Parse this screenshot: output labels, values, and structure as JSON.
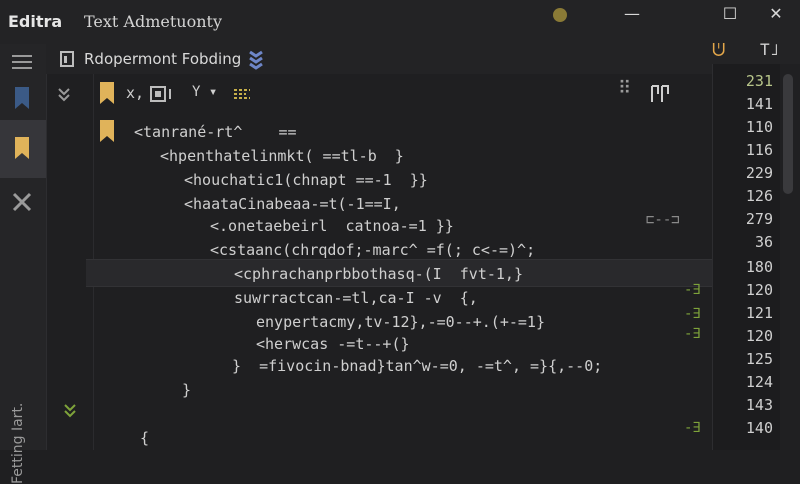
{
  "window": {
    "app_name": "Editra",
    "subtitle": "Text Admetuonty",
    "minimize": "—",
    "maximize": "☐",
    "close": "✕"
  },
  "tab": {
    "title": "Rdopermont Fobding",
    "actions": [
      "ᕫ",
      "T˩"
    ]
  },
  "toolbar": {
    "x_label": "x,",
    "filter_label": "Y ▾",
    "dots": "⠿"
  },
  "sidebar": {
    "vertical_label": "Fetting Iart."
  },
  "code_lines": [
    {
      "indent": 0,
      "text": "<tanrané-rt^    ==",
      "color": "#d6d6d6"
    },
    {
      "indent": 1,
      "text": "<hpenthatelinmkt( ==tl-b  }",
      "color": "#d9d9d9"
    },
    {
      "indent": 2,
      "text": "<houchatic1(chnapt ==-1  }}",
      "color": "#d9d9d9"
    },
    {
      "indent": 2,
      "text": "<haataCinabeaa-=t(-1==I,",
      "color": "#d9d9d9"
    },
    {
      "indent": 3,
      "text": "<.onetaebeirl  catnoa-=1 }}",
      "color": "#d9d9d9"
    },
    {
      "indent": 3,
      "text": "<cstaanc(chrqdof;-marc^ =f(; c<-=)^;",
      "color": "#d9d9d9"
    },
    {
      "indent": 4,
      "text": "<cphrachanprbbothasq-(I  fvt-1,}",
      "color": "#d9d9d9"
    },
    {
      "indent": 4,
      "text": "suwrractcan-=tl,ca-I -v  {,",
      "color": "#d9d9d9"
    },
    {
      "indent": 5,
      "text": "enypertacmy,tv-12},-=0--+.(+-=1}",
      "color": "#d9d9d9"
    },
    {
      "indent": 5,
      "text": "<herwcas -=t--+(}",
      "color": "#d9d9d9"
    },
    {
      "indent": 4,
      "text": "}  =fivocin-bnad}tan^w-=0, -=t^, =}{,--0;",
      "color": "#d9d9d9"
    },
    {
      "indent": 3,
      "text": "}",
      "color": "#d9d9d9"
    },
    {
      "indent": 1,
      "text": "{",
      "color": "#d9d9d9"
    }
  ],
  "line_numbers": [
    "231",
    "141",
    "110",
    "116",
    "229",
    "126",
    "279",
    "36",
    "180",
    "120",
    "121",
    "120",
    "125",
    "124",
    "143",
    "140"
  ],
  "fold_markers": [
    "⊏--⊐",
    "-∃",
    "-∃",
    "-∃",
    "-∃"
  ],
  "colors": {
    "accent": "#e4a74a",
    "bookmark": "#e0b35a",
    "side_bookmark": "#3b5a86",
    "marker": "#7ea33a"
  }
}
